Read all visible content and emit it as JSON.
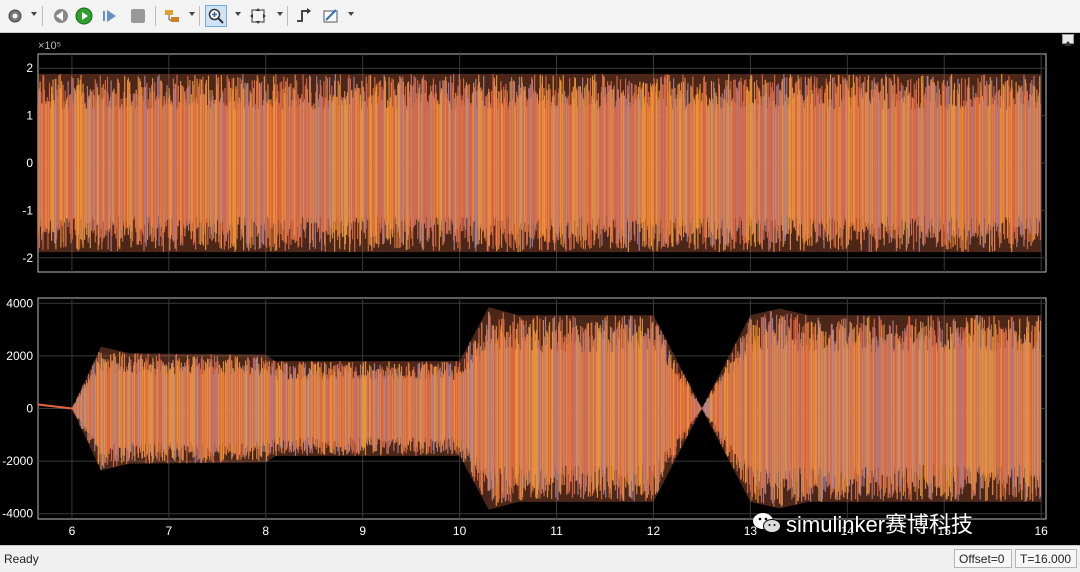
{
  "toolbar": {
    "buttons": [
      {
        "name": "settings",
        "icon": "gear-icon",
        "has_dropdown": true
      },
      {
        "name": "step-back",
        "icon": "step-back-icon",
        "has_dropdown": false
      },
      {
        "name": "run",
        "icon": "run-icon",
        "has_dropdown": false
      },
      {
        "name": "step-forward",
        "icon": "step-forward-icon",
        "has_dropdown": false
      },
      {
        "name": "stop",
        "icon": "stop-icon",
        "has_dropdown": false
      },
      {
        "name": "highlight",
        "icon": "highlight-icon",
        "has_dropdown": true
      },
      {
        "name": "zoom-in",
        "icon": "zoom-in-icon",
        "has_dropdown": true,
        "active": true
      },
      {
        "name": "autoscale",
        "icon": "autoscale-icon",
        "has_dropdown": true
      },
      {
        "name": "triggers",
        "icon": "trigger-icon",
        "has_dropdown": false
      },
      {
        "name": "measurements",
        "icon": "measure-icon",
        "has_dropdown": true
      }
    ]
  },
  "colors": {
    "background": "#000000",
    "axes_text": "#ffffff",
    "grid": "#3a3a3a",
    "series": [
      "#e8643c",
      "#8e8ec8",
      "#ffb020",
      "#d86a4a",
      "#f0a050"
    ]
  },
  "chart_data": [
    {
      "type": "line",
      "title": "",
      "xlabel": "",
      "ylabel": "",
      "exponent_label": "×10⁵",
      "xlim": [
        5.65,
        16.05
      ],
      "ylim": [
        -2.3,
        2.3
      ],
      "yticks": [
        -2,
        -1,
        0,
        1,
        2
      ],
      "xticks": [
        6,
        7,
        8,
        9,
        10,
        11,
        12,
        13,
        14,
        15,
        16
      ],
      "grid": true,
      "envelope": {
        "t": [
          5.65,
          16.0
        ],
        "amplitude": [
          1.88,
          1.88
        ]
      }
    },
    {
      "type": "line",
      "title": "",
      "xlabel": "",
      "ylabel": "",
      "xlim": [
        5.65,
        16.05
      ],
      "ylim": [
        -4200,
        4200
      ],
      "yticks": [
        -4000,
        -2000,
        0,
        2000,
        4000
      ],
      "xticks": [
        6,
        7,
        8,
        9,
        10,
        11,
        12,
        13,
        14,
        15,
        16
      ],
      "xticklabels": [
        "6",
        "7",
        "8",
        "9",
        "10",
        "11",
        "12",
        "13",
        "14",
        "15",
        "16"
      ],
      "grid": true,
      "pre_signal": {
        "t": [
          5.65,
          6.0
        ],
        "value": 150
      },
      "envelope": {
        "t": [
          6.0,
          6.3,
          6.6,
          8.0,
          8.1,
          10.0,
          10.3,
          10.6,
          12.0,
          12.5,
          13.0,
          13.3,
          13.6,
          16.0
        ],
        "amplitude": [
          0,
          2350,
          2100,
          2050,
          1800,
          1800,
          3850,
          3550,
          3550,
          0,
          3550,
          3800,
          3550,
          3550
        ]
      }
    }
  ],
  "status": {
    "text": "Ready",
    "offset": "Offset=0",
    "time": "T=16.000"
  },
  "watermark": {
    "icon": "wechat-icon",
    "text": "simulinker赛博科技"
  }
}
